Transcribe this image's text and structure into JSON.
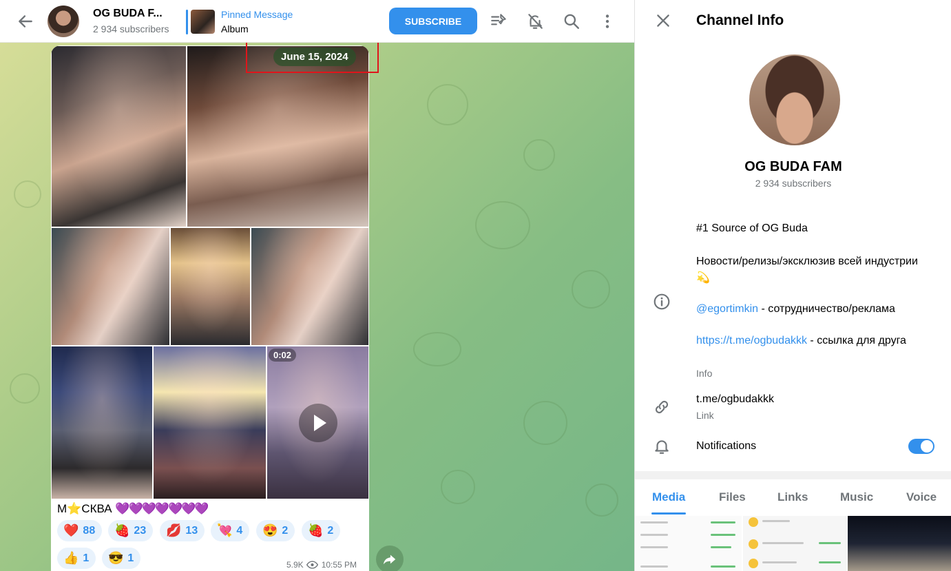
{
  "header": {
    "channel_title": "OG BUDA F...",
    "subscribers": "2 934 subscribers",
    "pinned_label": "Pinned Message",
    "pinned_text": "Album",
    "subscribe_label": "SUBSCRIBE"
  },
  "message": {
    "date": "June 15, 2024",
    "video_duration": "0:02",
    "caption_prefix": "М",
    "caption_star": "⭐",
    "caption_word": "СКВА",
    "caption_hearts": "💜💜💜💜💜💜💜",
    "reactions": [
      {
        "emoji": "❤️",
        "count": "88"
      },
      {
        "emoji": "🍓",
        "count": "23"
      },
      {
        "emoji": "💋",
        "count": "13"
      },
      {
        "emoji": "💘",
        "count": "4"
      },
      {
        "emoji": "😍",
        "count": "2"
      },
      {
        "emoji": "🍓",
        "count": "2"
      },
      {
        "emoji": "👍",
        "count": "1"
      },
      {
        "emoji": "😎",
        "count": "1"
      }
    ],
    "views": "5.9K",
    "time": "10:55 PM"
  },
  "info_panel": {
    "title": "Channel Info",
    "channel_name": "OG BUDA FAM",
    "subscribers": "2 934 subscribers",
    "desc_line1": "#1 Source of OG Buda",
    "desc_line2": "Новости/релизы/эксклюзив всей индустрии",
    "desc_line2_emoji": "💫",
    "desc_mention": "@egortimkin",
    "desc_mention_rest": " - сотрудничество/реклама",
    "desc_url": "https://t.me/ogbudakkk",
    "desc_url_rest": " -  ссылка для друга",
    "info_label": "Info",
    "link_value": "t.me/ogbudakkk",
    "link_label": "Link",
    "notifications_label": "Notifications",
    "tabs": [
      "Media",
      "Files",
      "Links",
      "Music",
      "Voice"
    ]
  }
}
